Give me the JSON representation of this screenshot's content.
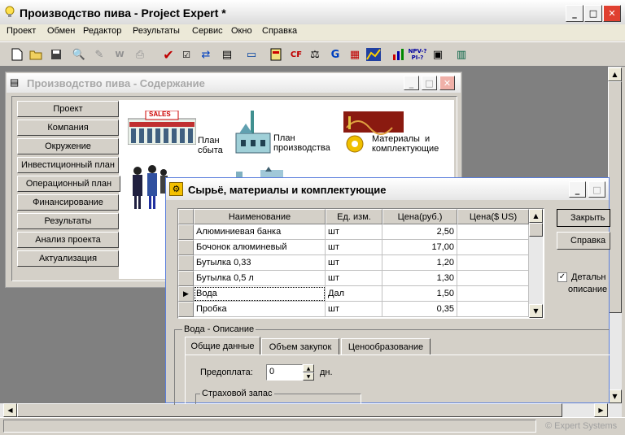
{
  "main_window": {
    "title": "Производство пива - Project Expert *",
    "minimize": "_",
    "maximize": "□",
    "close": "✕"
  },
  "menu": [
    "Проект",
    "Обмен",
    "Редактор",
    "Результаты",
    "Сервис",
    "Окно",
    "Справка"
  ],
  "toolbar_icons": [
    "new-icon",
    "open-icon",
    "save-icon",
    "preview-icon",
    "link-icon",
    "word-icon",
    "print-icon",
    "check-icon",
    "checklist-icon",
    "exchange-icon",
    "card-icon",
    "window-icon",
    "chart-icon",
    "cashflow-icon",
    "scales-icon",
    "gear-g-icon",
    "report-icon",
    "graph-icon",
    "bar-chart-icon",
    "npv-icon",
    "calc-icon",
    "report2-icon"
  ],
  "toolbar_text": {
    "npv": "NPV-?",
    "pi": "PI-?"
  },
  "content_window": {
    "title": "Производство пива - Содержание",
    "nav": [
      "Проект",
      "Компания",
      "Окружение",
      "Инвестиционный план",
      "Операционный план",
      "Финансирование",
      "Результаты",
      "Анализ проекта",
      "Актуализация"
    ],
    "sales_plan": {
      "line1": "План",
      "line2": "сбыта",
      "sign": "SALES"
    },
    "production_plan": {
      "line1": "План",
      "line2": "производства"
    },
    "materials": {
      "line1": "Материалы  и",
      "line2": "комплектующие"
    }
  },
  "materials_window": {
    "title": "Сырьё, материалы и комплектующие",
    "columns": [
      "Наименование",
      "Ед. изм.",
      "Цена(руб.)",
      "Цена($ US)"
    ],
    "rows": [
      {
        "name": "Алюминиевая банка",
        "unit": "шт",
        "price_rub": "2,50",
        "price_usd": ""
      },
      {
        "name": "Бочонок алюминевый",
        "unit": "шт",
        "price_rub": "17,00",
        "price_usd": ""
      },
      {
        "name": "Бутылка 0,33",
        "unit": "шт",
        "price_rub": "1,20",
        "price_usd": ""
      },
      {
        "name": "Бутылка 0,5 л",
        "unit": "шт",
        "price_rub": "1,30",
        "price_usd": ""
      },
      {
        "name": "Вода",
        "unit": "Дал",
        "price_rub": "1,50",
        "price_usd": ""
      },
      {
        "name": "Пробка",
        "unit": "шт",
        "price_rub": "0,35",
        "price_usd": ""
      }
    ],
    "close_button": "Закрыть",
    "help_button": "Справка",
    "detailed_checkbox": {
      "line1": "Детальн",
      "line2": "описание",
      "checked": true
    },
    "description_group": "Вода - Описание",
    "tabs": [
      "Общие данные",
      "Объем закупок",
      "Ценообразование"
    ],
    "prepayment_label": "Предоплата:",
    "prepayment_value": "0",
    "prepayment_unit": "дн.",
    "safety_stock_group": "Страховой запас"
  },
  "status_bar": {
    "text": "© Expert Systems"
  },
  "colors": {
    "titlebar_active": "#0a246a",
    "titlebar_inactive": "#7a96df",
    "desktop": "#808080"
  }
}
